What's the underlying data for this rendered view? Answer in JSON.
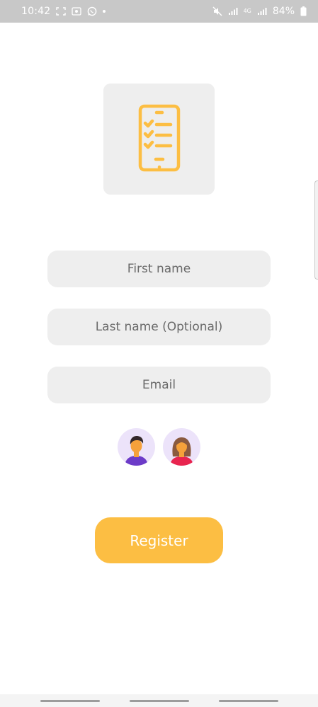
{
  "status_bar": {
    "time": "10:42",
    "network": "4G",
    "battery_percent": "84%",
    "icons": [
      "screenshot-icon",
      "screen-record-icon",
      "whatsapp-icon",
      "notification-dot-icon",
      "mute-icon",
      "signal-icon",
      "signal-icon",
      "battery-icon"
    ]
  },
  "logo": {
    "icon": "checklist-clipboard-icon",
    "color": "#fcbe43"
  },
  "form": {
    "first_name_placeholder": "First name",
    "last_name_placeholder": "Last name (Optional)",
    "email_placeholder": "Email"
  },
  "gender": {
    "options": [
      "male-avatar-icon",
      "female-avatar-icon"
    ]
  },
  "actions": {
    "register_label": "Register"
  },
  "colors": {
    "accent": "#fcbe43",
    "field_background": "#eeeeee",
    "avatar_background": "#ece3fa"
  }
}
